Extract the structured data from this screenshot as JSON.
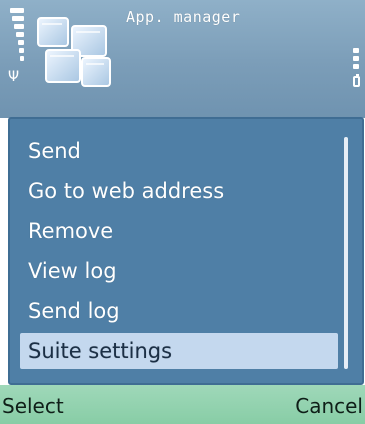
{
  "status": {
    "app_title": "App. manager",
    "signal_icon": "antenna-icon",
    "battery_icon": "battery-icon"
  },
  "menu": {
    "items": [
      {
        "label": "Send",
        "selected": false
      },
      {
        "label": "Go to web address",
        "selected": false
      },
      {
        "label": "Remove",
        "selected": false
      },
      {
        "label": "View log",
        "selected": false
      },
      {
        "label": "Send log",
        "selected": false
      },
      {
        "label": "Suite settings",
        "selected": true
      }
    ]
  },
  "softkeys": {
    "left": "Select",
    "right": "Cancel"
  },
  "colors": {
    "status_bg": "#7b9db8",
    "menu_bg": "#4f7fa6",
    "highlight_bg": "#c4d8ee",
    "softkey_bg": "#88cda6"
  }
}
